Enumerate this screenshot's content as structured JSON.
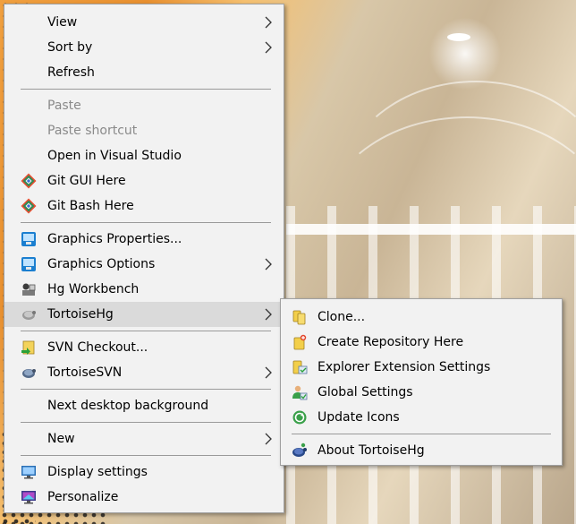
{
  "main_menu": {
    "items": [
      {
        "label": "View"
      },
      {
        "label": "Sort by"
      },
      {
        "label": "Refresh"
      },
      {
        "label": "Paste"
      },
      {
        "label": "Paste shortcut"
      },
      {
        "label": "Open in Visual Studio"
      },
      {
        "label": "Git GUI Here"
      },
      {
        "label": "Git Bash Here"
      },
      {
        "label": "Graphics Properties..."
      },
      {
        "label": "Graphics Options"
      },
      {
        "label": "Hg Workbench"
      },
      {
        "label": "TortoiseHg"
      },
      {
        "label": "SVN Checkout..."
      },
      {
        "label": "TortoiseSVN"
      },
      {
        "label": "Next desktop background"
      },
      {
        "label": "New"
      },
      {
        "label": "Display settings"
      },
      {
        "label": "Personalize"
      }
    ]
  },
  "sub_menu": {
    "items": [
      {
        "label": "Clone..."
      },
      {
        "label": "Create Repository Here"
      },
      {
        "label": "Explorer Extension Settings"
      },
      {
        "label": "Global Settings"
      },
      {
        "label": "Update Icons"
      },
      {
        "label": "About TortoiseHg"
      }
    ]
  },
  "colors": {
    "menu_bg": "#f2f2f2",
    "highlight": "#dadada",
    "disabled_text": "#8a8a8a",
    "separator": "#9a9a9a"
  }
}
